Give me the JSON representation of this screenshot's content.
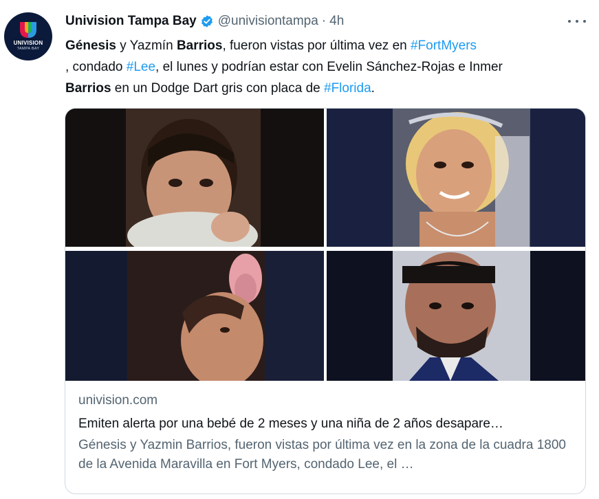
{
  "account": {
    "display_name": "Univision Tampa Bay",
    "handle": "@univisiontampa",
    "separator": "·",
    "time": "4h",
    "avatar_logo_word": "UNIVISION",
    "avatar_logo_sub": "TAMPA BAY"
  },
  "tweet_text": [
    {
      "text": "Génesis",
      "style": "bold"
    },
    {
      "text": " y Yazmín ",
      "style": "plain"
    },
    {
      "text": "Barrios",
      "style": "bold"
    },
    {
      "text": ", fueron vistas por última vez en ",
      "style": "plain"
    },
    {
      "text": "#FortMyers",
      "style": "hashtag"
    },
    {
      "text": ", condado ",
      "style": "plain"
    },
    {
      "text": "#Lee",
      "style": "hashtag"
    },
    {
      "text": ", el lunes y podrían estar con Evelin Sánchez-Rojas e Inmer ",
      "style": "plain"
    },
    {
      "text": "Barrios",
      "style": "bold"
    },
    {
      "text": " en un Dodge Dart gris con placa de ",
      "style": "plain"
    },
    {
      "text": "#Florida",
      "style": "hashtag"
    },
    {
      "text": ".",
      "style": "plain"
    }
  ],
  "link_card": {
    "domain": "univision.com",
    "title": "Emiten alerta por una bebé de 2 meses y una niña de 2 años desapare…",
    "description": "Génesis y Yazmin Barrios, fueron vistas por última vez en la zona de la cuadra 1800 de la Avenida Maravilla en Fort Myers, condado Lee, el …"
  },
  "colors": {
    "hashtag": "#1d9bf0",
    "secondary_text": "#536471",
    "primary_text": "#0f1419",
    "verified_badge": "#1d9bf0",
    "card_border": "#cfd9de"
  },
  "icons": [
    "verified-badge-icon",
    "more-options-icon",
    "univision-logo-icon"
  ]
}
